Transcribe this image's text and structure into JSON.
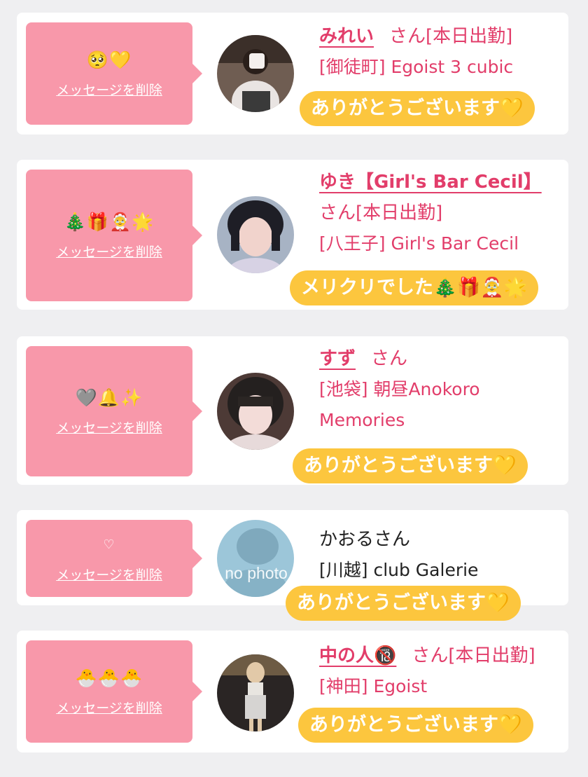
{
  "delete_label": "メッセージを削除",
  "colors": {
    "bubble": "#f898aa",
    "name": "#e23d6a",
    "reply_badge": "#fcc63e",
    "background": "#efeff1"
  },
  "messages": [
    {
      "emoji": "🥺💛",
      "name": "みれい",
      "suffix": "さん[本日出勤]",
      "shop": "[御徒町] Egoist 3 cubic",
      "reply": "ありがとうございます💛"
    },
    {
      "emoji": "🎄🎁🤶🌟",
      "name": "ゆき【Girl's Bar Cecil】",
      "suffix": "さん[本日出勤]",
      "shop": "[八王子] Girl's Bar Cecil",
      "reply": "メリクリでした🎄🎁🤶🌟"
    },
    {
      "emoji": "🩶🔔✨",
      "name": "すず",
      "suffix": "さん",
      "shop": "[池袋] 朝昼Anokoro Memories",
      "reply": "ありがとうございます💛"
    },
    {
      "emoji": "♡",
      "name": "かおるさん",
      "suffix": "",
      "shop": "[川越] club Galerie",
      "reply": "ありがとうございます💛",
      "avatar_text": "no photo"
    },
    {
      "emoji": "🐣🐣🐣",
      "name": "中の人🔞",
      "suffix": "さん[本日出勤]",
      "shop": "[神田] Egoist",
      "reply": "ありがとうございます💛"
    }
  ]
}
